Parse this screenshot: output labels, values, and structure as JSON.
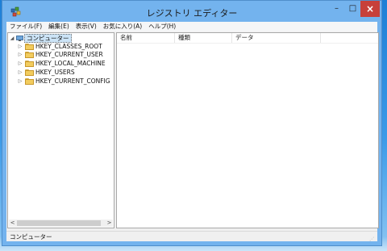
{
  "window": {
    "title": "レジストリ エディター",
    "controls": {
      "minimize": "–",
      "maximize": "□",
      "close": "×"
    }
  },
  "menu": [
    "ファイル(F)",
    "編集(E)",
    "表示(V)",
    "お気に入り(A)",
    "ヘルプ(H)"
  ],
  "tree": {
    "root": {
      "label": "コンピューター",
      "expander": "◢"
    },
    "items": [
      {
        "label": "HKEY_CLASSES_ROOT",
        "expander": "▷"
      },
      {
        "label": "HKEY_CURRENT_USER",
        "expander": "▷"
      },
      {
        "label": "HKEY_LOCAL_MACHINE",
        "expander": "▷"
      },
      {
        "label": "HKEY_USERS",
        "expander": "▷"
      },
      {
        "label": "HKEY_CURRENT_CONFIG",
        "expander": "▷"
      }
    ],
    "scroll": {
      "left": "<",
      "right": ">"
    }
  },
  "list": {
    "columns": [
      "名前",
      "種類",
      "データ"
    ]
  },
  "status": {
    "path": "コンピューター"
  },
  "colors": {
    "titlebar": "#73b3ee",
    "close_button": "#c7403a",
    "selection": "#cce4f7",
    "folder": "#f2cc5e"
  },
  "icons": {
    "app": "registry-editor-icon",
    "root": "computer-icon",
    "key": "folder-icon"
  }
}
